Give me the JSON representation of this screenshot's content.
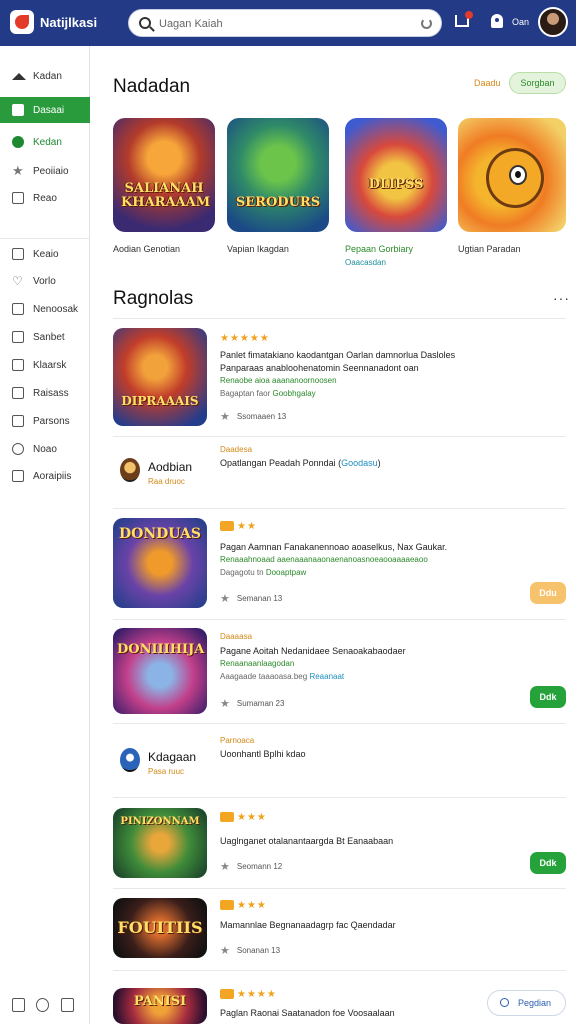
{
  "header": {
    "app_title": "Natijlkasi",
    "search_placeholder": "Uagan Kaiah",
    "user_name": "Oan",
    "icons": [
      "app-logo-icon",
      "search-icon",
      "refresh-icon",
      "cart-icon",
      "bell-icon"
    ]
  },
  "sidebar": {
    "items": [
      {
        "label": "Kadan",
        "icon": "home-icon"
      },
      {
        "label": "Dasaai",
        "icon": "square-icon",
        "state": "active"
      },
      {
        "label": "Kedan",
        "icon": "dot-icon",
        "state": "highlight"
      },
      {
        "label": "Peoiiaio",
        "icon": "star-icon"
      },
      {
        "label": "Reao",
        "icon": "mail-icon"
      },
      {
        "label": "Keaio",
        "icon": "box-icon"
      },
      {
        "label": "Vorlo",
        "icon": "heart-icon"
      },
      {
        "label": "Nenoosak",
        "icon": "folder-icon"
      },
      {
        "label": "Sanbet",
        "icon": "inbox-icon"
      },
      {
        "label": "Klaarsk",
        "icon": "chart-icon"
      },
      {
        "label": "Raisass",
        "icon": "list-icon"
      },
      {
        "label": "Parsons",
        "icon": "people-icon"
      },
      {
        "label": "Noao",
        "icon": "help-icon"
      },
      {
        "label": "Aoraipiis",
        "icon": "check-icon"
      }
    ],
    "bottom_icons": [
      "trash-icon",
      "clock-icon",
      "gift-icon"
    ]
  },
  "featured": {
    "title": "Nadadan",
    "link": "Daadu",
    "chip": "Sorgban",
    "tiles": [
      {
        "art": "SALIANAH KHARAAAM",
        "label": "Aodian Genotian"
      },
      {
        "art": "SERODURS",
        "label": "Vapian Ikagdan"
      },
      {
        "art": "DLIPSS",
        "label": "Pepaan Gorbiary",
        "sub": "Oaacasdan"
      },
      {
        "art": "",
        "label": "Ugtian Paradan"
      }
    ]
  },
  "list": {
    "title": "Ragnolas",
    "items": [
      {
        "art": "DIPRAAAIS",
        "stars": "★★★★★",
        "desc": [
          "Panlet fimatakiano kaodantgan Oarlan damnorlua Dasloles",
          "Panparaas anabloohenatomin  Seennanadont oan"
        ],
        "desc_green": "Renaobe aioa aaananoornoosen",
        "meta": "Bagaptan faor",
        "meta_green": "Goobhgalay",
        "rating": "Ssomaaen  13"
      },
      {
        "name": "Aodbian",
        "sub": "Raa druoc",
        "cat": "Daadesa",
        "desc": "Opatlangan Peadah Ponndai",
        "desc_link": "Goodasu"
      },
      {
        "art": "DONDUAS",
        "stars": "★★",
        "desc": "Pagan  Aamnan Fanakanennoao aoaselkus, Nax Gaukar.",
        "desc_green": "Renaaahnoaad aaenaaanaaonaenanoasnoeaooaaaaeaoo",
        "meta": "Dagagotu tn",
        "meta_green": "Dooaptpaw",
        "rating": "Semanan  13",
        "action": "Ddu"
      },
      {
        "art": "DONIIIHIJA",
        "cat": "Daaaasa",
        "desc": "Pagane Aoitah Nedanidaee Senaoakabaodaer",
        "desc_green": "Renaanaanlaagodan",
        "meta": "Aaagaade taaaoasa.beg",
        "meta_blue": "Reaanaat",
        "rating": "Sumaman  23",
        "action": "Ddk"
      },
      {
        "name": "Kdagaan",
        "sub": "Pasa ruuc",
        "cat": "Parnoaca",
        "desc": "Uoonhantl  Bplhi kdao"
      },
      {
        "art": "PINIZONNAM",
        "stars": "★★★",
        "desc": "Uaglnganet otalanantaargda  Bt Eanaabaan",
        "rating": "Seomann  12",
        "action": "Ddk"
      },
      {
        "art": "FOUITIIS",
        "stars": "★★★",
        "desc": "Mamannlae Begnanaadagrp  fac Qaendadar",
        "rating": "Sonanan  13"
      },
      {
        "art": "PANISI",
        "stars": "★★★★",
        "desc": "Paglan Raonai Saatanadon  foe Voosaalaan"
      }
    ]
  },
  "float_button": "Pegdian",
  "colors": {
    "header_bg": "#233a86",
    "active_green": "#2a9b3c",
    "accent_orange": "#f0a21c",
    "link_blue": "#1f8ec0"
  }
}
